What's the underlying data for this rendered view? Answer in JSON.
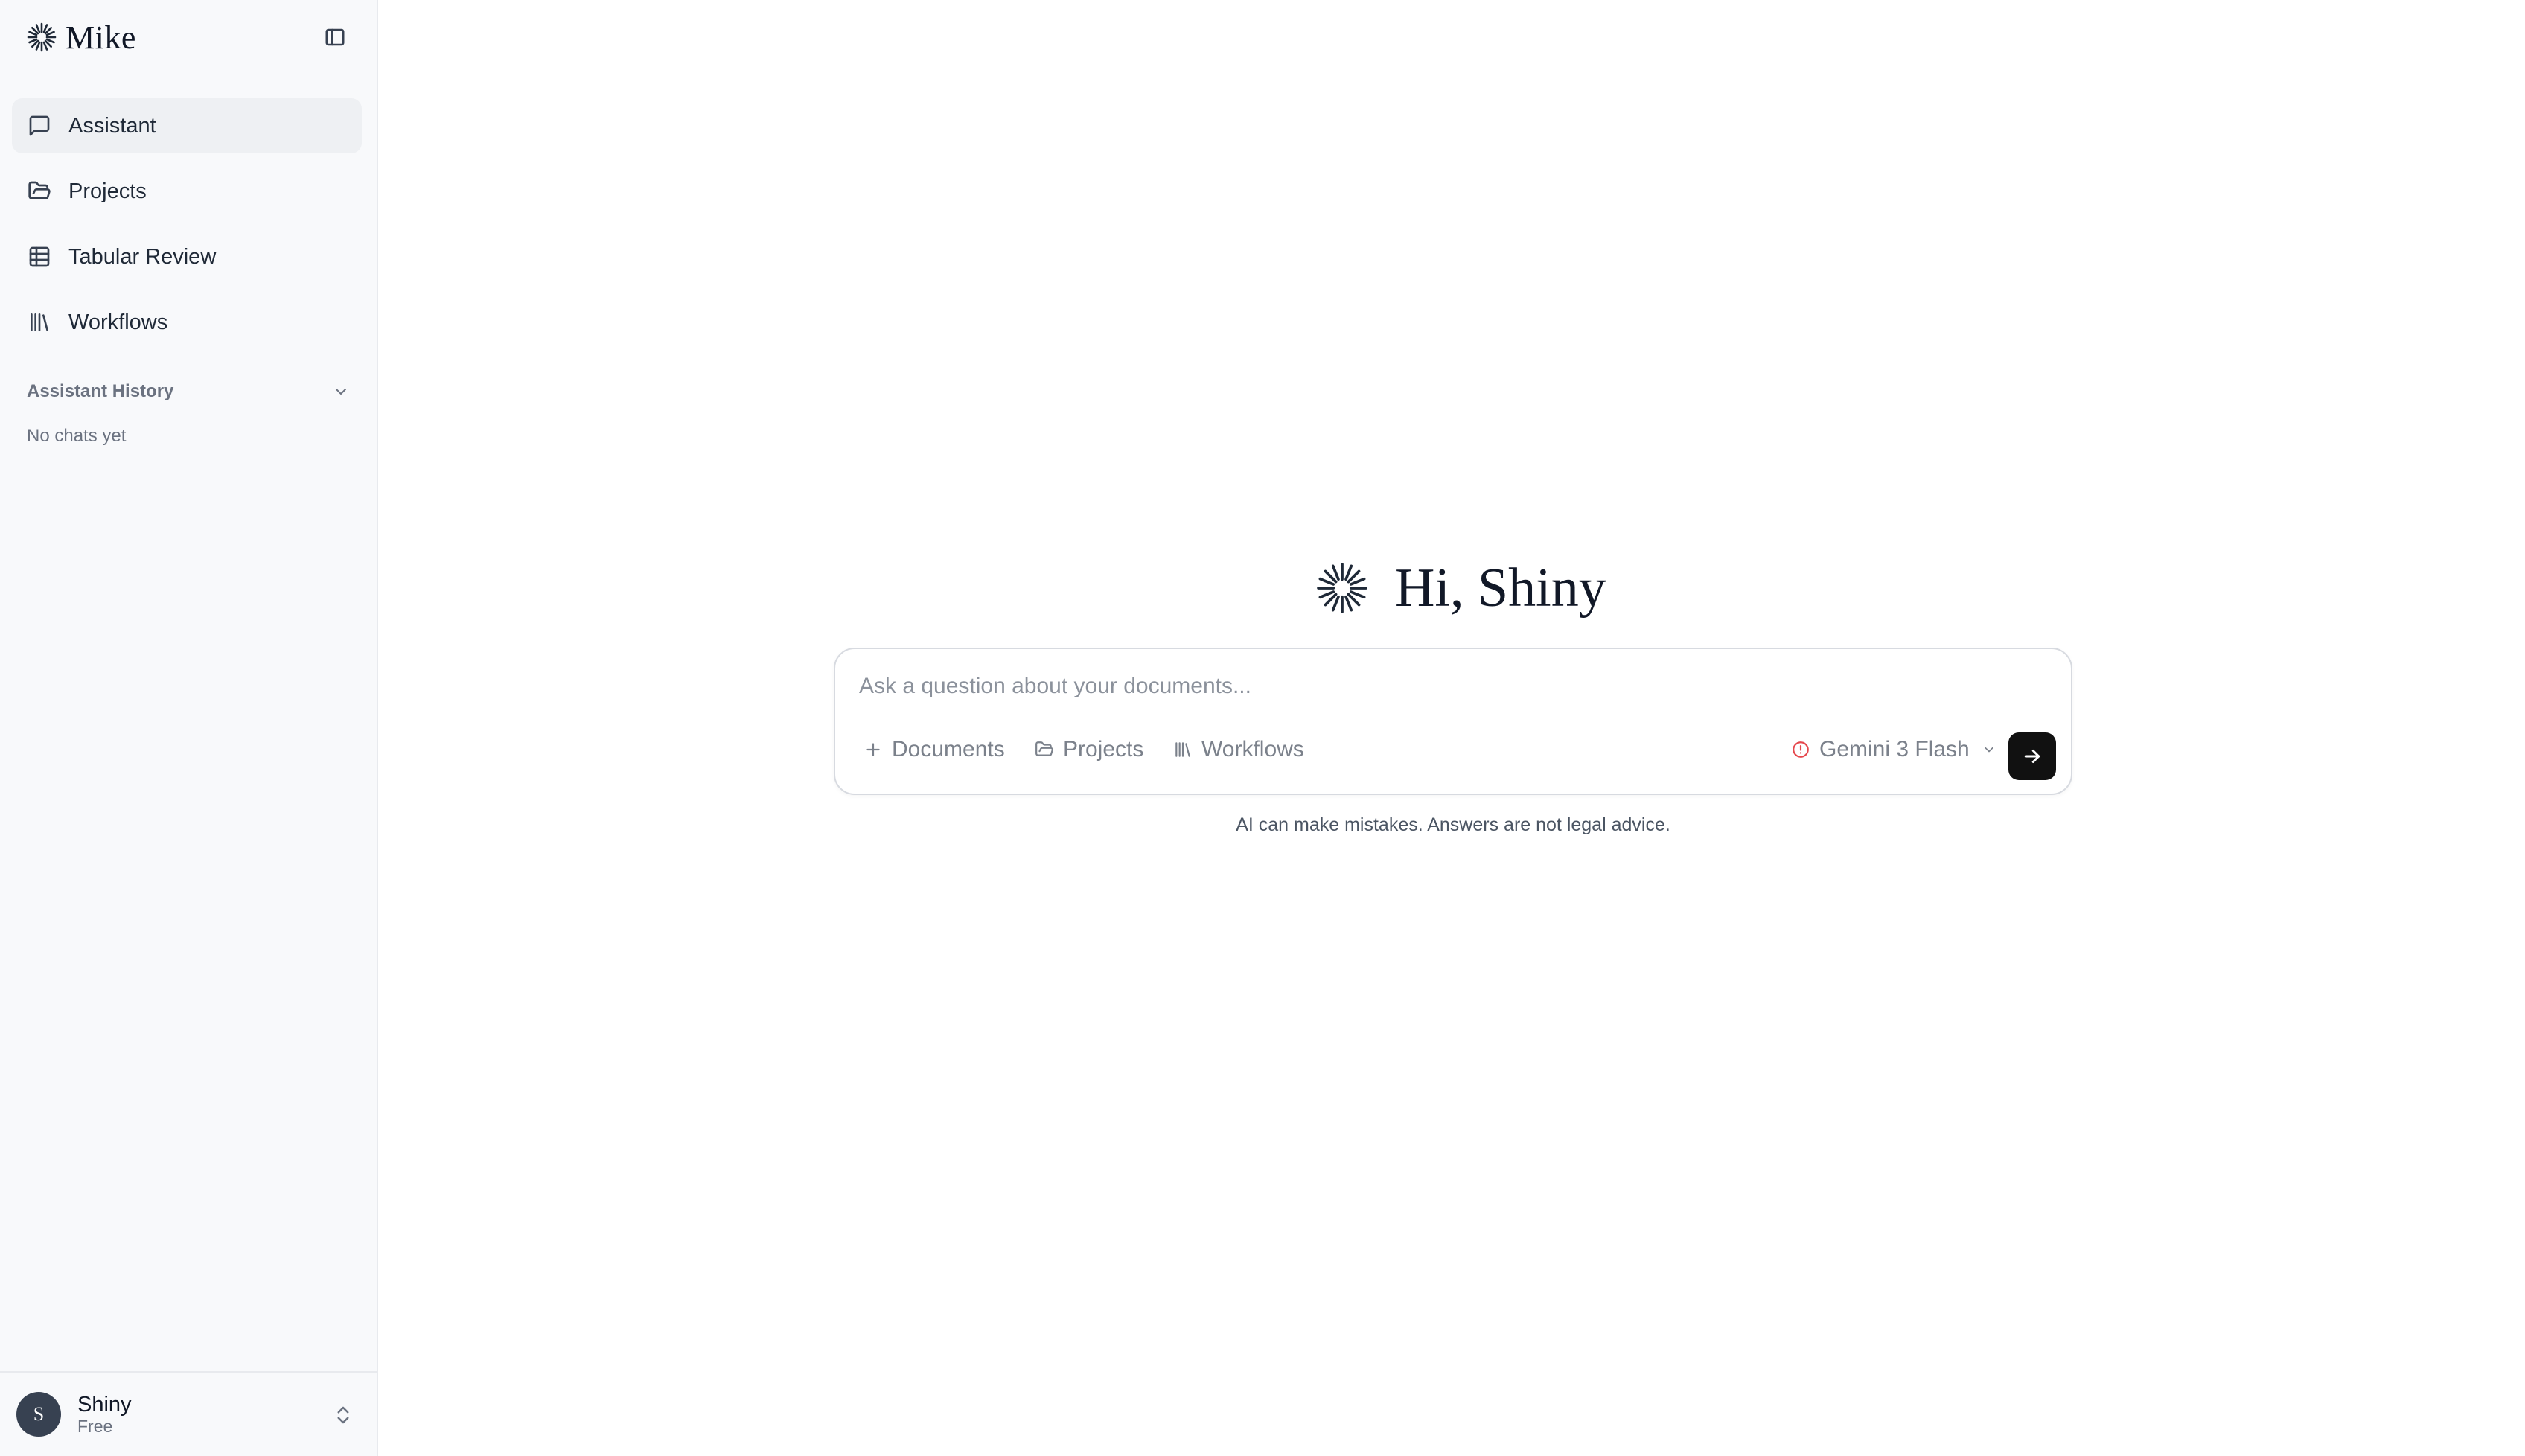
{
  "app": {
    "brand_name": "Mike"
  },
  "sidebar": {
    "nav": [
      {
        "label": "Assistant",
        "icon": "chat-bubble-icon",
        "active": true
      },
      {
        "label": "Projects",
        "icon": "folder-icon",
        "active": false
      },
      {
        "label": "Tabular Review",
        "icon": "table-icon",
        "active": false
      },
      {
        "label": "Workflows",
        "icon": "library-icon",
        "active": false
      }
    ],
    "history": {
      "title": "Assistant History",
      "empty_text": "No chats yet"
    },
    "user": {
      "initial": "S",
      "name": "Shiny",
      "plan": "Free"
    }
  },
  "main": {
    "greeting": "Hi, Shiny",
    "composer": {
      "placeholder": "Ask a question about your documents...",
      "chips": {
        "documents": "Documents",
        "projects": "Projects",
        "workflows": "Workflows"
      },
      "model": "Gemini 3 Flash",
      "model_status_color": "#e5484d"
    },
    "disclaimer": "AI can make mistakes. Answers are not legal advice."
  }
}
